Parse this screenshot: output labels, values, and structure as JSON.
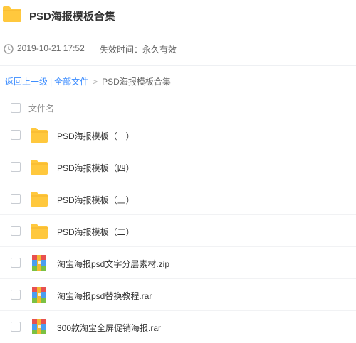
{
  "share": {
    "title": "PSD海报模板合集",
    "date": "2019-10-21 17:52",
    "expiry": "失效时间：永久有效"
  },
  "breadcrumb": {
    "back": "返回上一级",
    "divider": "|",
    "all_files": "全部文件",
    "arrow": ">",
    "current": "PSD海报模板合集"
  },
  "list": {
    "header": "文件名",
    "items": [
      {
        "name": "PSD海报模板（一）",
        "icon": "folder-icon"
      },
      {
        "name": "PSD海报模板（四）",
        "icon": "folder-icon"
      },
      {
        "name": "PSD海报模板（三）",
        "icon": "folder-icon"
      },
      {
        "name": "PSD海报模板（二）",
        "icon": "folder-icon"
      },
      {
        "name": "淘宝海报psd文字分层素材.zip",
        "icon": "archive-icon"
      },
      {
        "name": "淘宝海报psd替换教程.rar",
        "icon": "archive-icon"
      },
      {
        "name": "300款淘宝全屏促销海报.rar",
        "icon": "archive-icon"
      }
    ]
  },
  "colors": {
    "folder": "#FFC83D",
    "link": "#3B8CFF",
    "archive_red": "#E8504F",
    "archive_green": "#7BC142",
    "archive_blue": "#4A9DF0",
    "archive_yellow": "#F5B932"
  }
}
